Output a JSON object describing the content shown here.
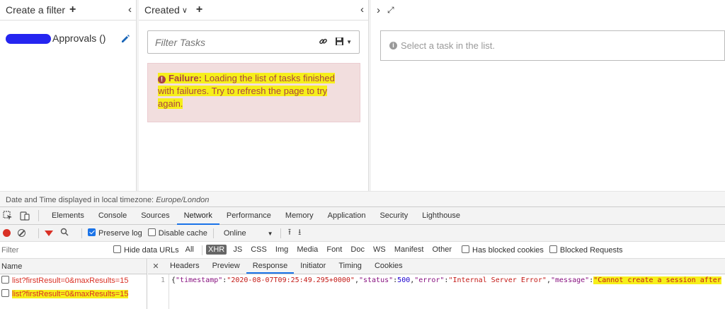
{
  "tasklist": {
    "filters": {
      "header": "Create a filter",
      "plus": "+",
      "collapse": "‹",
      "item_label": "Approvals ()",
      "edit_icon": "pencil-icon"
    },
    "list": {
      "sort_label": "Created",
      "plus": "+",
      "collapse": "‹",
      "filter_placeholder": "Filter Tasks",
      "alert_title": "Failure:",
      "alert_text": "Loading the list of tasks finished with failures. Try to refresh the page to try again."
    },
    "task": {
      "expand": "›",
      "fullscreen": "⤢",
      "placeholder": "Select a task in the list."
    },
    "timezone_label": "Date and Time displayed in local timezone:",
    "timezone_value": "Europe/London"
  },
  "devtools": {
    "tabs": [
      "Elements",
      "Console",
      "Sources",
      "Network",
      "Performance",
      "Memory",
      "Application",
      "Security",
      "Lighthouse"
    ],
    "active_tab": "Network",
    "toolbar": {
      "preserve_log": "Preserve log",
      "disable_cache": "Disable cache",
      "throttle": "Online"
    },
    "filter_placeholder": "Filter",
    "hide_data_urls": "Hide data URLs",
    "types": [
      "All",
      "XHR",
      "JS",
      "CSS",
      "Img",
      "Media",
      "Font",
      "Doc",
      "WS",
      "Manifest",
      "Other"
    ],
    "active_type": "XHR",
    "has_blocked_cookies": "Has blocked cookies",
    "blocked_requests": "Blocked Requests",
    "name_header": "Name",
    "requests": [
      "list?firstResult=0&maxResults=15",
      "list?firstResult=0&maxResults=15"
    ],
    "detail_tabs": [
      "Headers",
      "Preview",
      "Response",
      "Initiator",
      "Timing",
      "Cookies"
    ],
    "active_detail_tab": "Response",
    "response": {
      "line_number": "1",
      "timestamp": "2020-08-07T09:25:49.295+0000",
      "status": "500",
      "error": "Internal Server Error",
      "message_fragment": "\"Cannot create a session after"
    }
  },
  "colors": {
    "highlight": "#f6ef1a",
    "alert_bg": "#f2dede",
    "alert_text": "#a94442",
    "devtools_accent": "#1a73e8",
    "error_red": "#d93025"
  }
}
